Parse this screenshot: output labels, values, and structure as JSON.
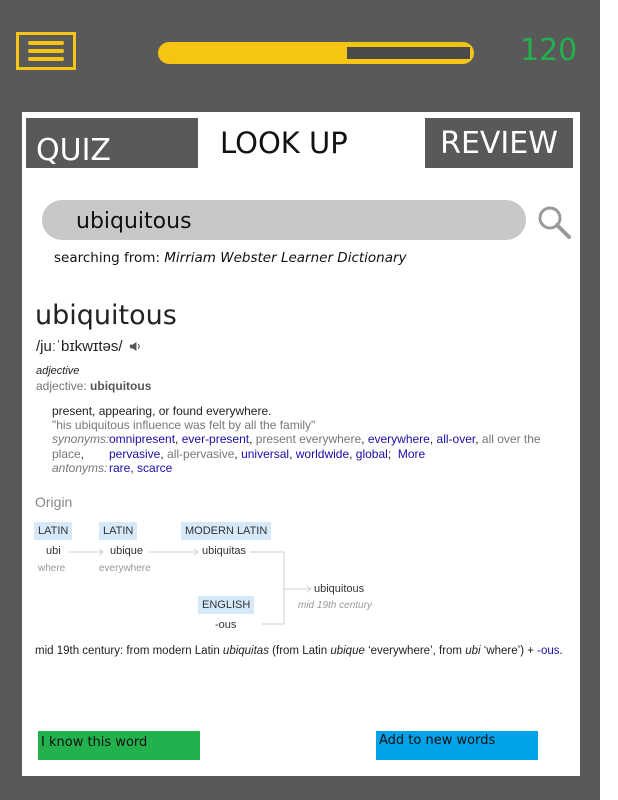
{
  "header": {
    "score": "120",
    "progress_fraction": 0.6
  },
  "tabs": {
    "quiz": "QUIZ",
    "lookup": "LOOK UP",
    "review": "REVIEW"
  },
  "search": {
    "value": "ubiquitous",
    "source_prefix": "searching from:",
    "source_name": "Mirriam Webster Learner Dictionary"
  },
  "entry": {
    "word": "ubiquitous",
    "pronunciation": "/juːˈbɪkwɪtəs/",
    "pos_italic": "adjective",
    "pos_label": "adjective:",
    "pos_value": "ubiquitous",
    "definition": "present, appearing, or found everywhere.",
    "example": "\"his ubiquitous influence was felt by all the family\"",
    "synonyms_label": "synonyms:",
    "synonyms": [
      "omnipresent",
      "ever-present",
      "present everywhere",
      "everywhere",
      "all-over",
      "all over the place",
      "pervasive",
      "all-pervasive",
      "universal",
      "worldwide",
      "global"
    ],
    "more": "More",
    "antonyms_label": "antonyms:",
    "antonyms": [
      "rare",
      "scarce"
    ]
  },
  "origin": {
    "title": "Origin",
    "langs": [
      "LATIN",
      "LATIN",
      "MODERN LATIN",
      "ENGLISH"
    ],
    "words": [
      "ubi",
      "ubique",
      "ubiquitas",
      "-ous",
      "ubiquitous"
    ],
    "glosses": [
      "where",
      "everywhere",
      "mid 19th century"
    ],
    "text": {
      "a": "mid 19th century: from modern Latin ",
      "b": "ubiquitas",
      "c": " (from Latin ",
      "d": "ubique",
      "e": " ‘everywhere’, from ",
      "f": "ubi",
      "g": " ‘where’) + ",
      "h": "-ous",
      "i": "."
    }
  },
  "actions": {
    "know": "I know this word",
    "add": "Add to new words"
  },
  "colors": {
    "accent": "#f6c412",
    "score": "#22b14c",
    "know": "#22b14c",
    "add": "#00a2e8",
    "frame": "#595959"
  }
}
